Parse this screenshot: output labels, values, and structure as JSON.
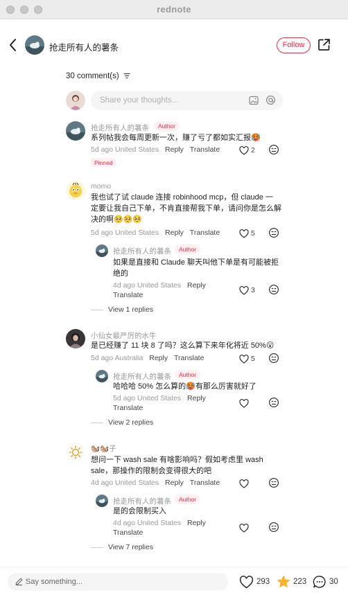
{
  "window": {
    "title": "rednote"
  },
  "header": {
    "post_author": "抢走所有人的薯条",
    "follow_label": "Follow"
  },
  "comments_header": {
    "count_label": "30 comment(s)"
  },
  "composer": {
    "placeholder": "Share your thoughts..."
  },
  "comments": [
    {
      "username": "抢走所有人的薯条",
      "author_tag": "Author",
      "text_lines": [
        "系列帖我会每周更新一次，赚了亏了都如实汇报🥵"
      ],
      "time": "5d ago",
      "location": "United States",
      "reply_label": "Reply",
      "translate_label": "Translate",
      "likes": "2",
      "pinned_label": "Pinned"
    },
    {
      "username": "momo",
      "text_lines": [
        "我也试了试 claude 连接 robinhood mcp，但 claude 一",
        "定要让我自己下单，不肯直接帮我下单，请问你是怎么解",
        "决的啊🥺🥺🥺"
      ],
      "time": "5d ago",
      "location": "United States",
      "reply_label": "Reply",
      "translate_label": "Translate",
      "likes": "5",
      "reply": {
        "username": "抢走所有人的薯条",
        "author_tag": "Author",
        "text_lines": [
          "如果是直接和 Claude 聊天叫他下单是有可能被拒",
          "绝的"
        ],
        "time": "4d ago",
        "location": "United States",
        "reply_label": "Reply",
        "translate_label": "Translate",
        "likes": "3"
      },
      "view_replies": "View 1 replies"
    },
    {
      "username": "小仙女最严厉的水牛",
      "text_lines": [
        "是已经赚了 11 块 8 了吗？这么算下来年化将近 50%😮"
      ],
      "time": "5d ago",
      "location": "Australia",
      "reply_label": "Reply",
      "translate_label": "Translate",
      "likes": "5",
      "reply": {
        "username": "抢走所有人的薯条",
        "author_tag": "Author",
        "text_lines": [
          "哈哈哈 50% 怎么算的🥵有那么厉害就好了"
        ],
        "time": "5d ago",
        "location": "United States",
        "reply_label": "Reply",
        "translate_label": "Translate",
        "likes": ""
      },
      "view_replies": "View 2 replies"
    },
    {
      "username": "🐿️🐿️子",
      "text_lines": [
        "想问一下 wash sale 有啥影响吗？假如考虑里 wash",
        "sale，那操作的限制会变得很大的吧"
      ],
      "time": "4d ago",
      "location": "United States",
      "reply_label": "Reply",
      "translate_label": "Translate",
      "likes": "",
      "reply": {
        "username": "抢走所有人的薯条",
        "author_tag": "Author",
        "text_lines": [
          "是的会限制买入"
        ],
        "time": "4d ago",
        "location": "United States",
        "reply_label": "Reply",
        "translate_label": "Translate",
        "likes": ""
      },
      "view_replies": "View 7 replies"
    }
  ],
  "footer": {
    "placeholder": "Say something...",
    "likes": "293",
    "collects": "223",
    "comments": "30"
  },
  "colors": {
    "accent": "#ff2442",
    "star": "#f7b52c"
  }
}
